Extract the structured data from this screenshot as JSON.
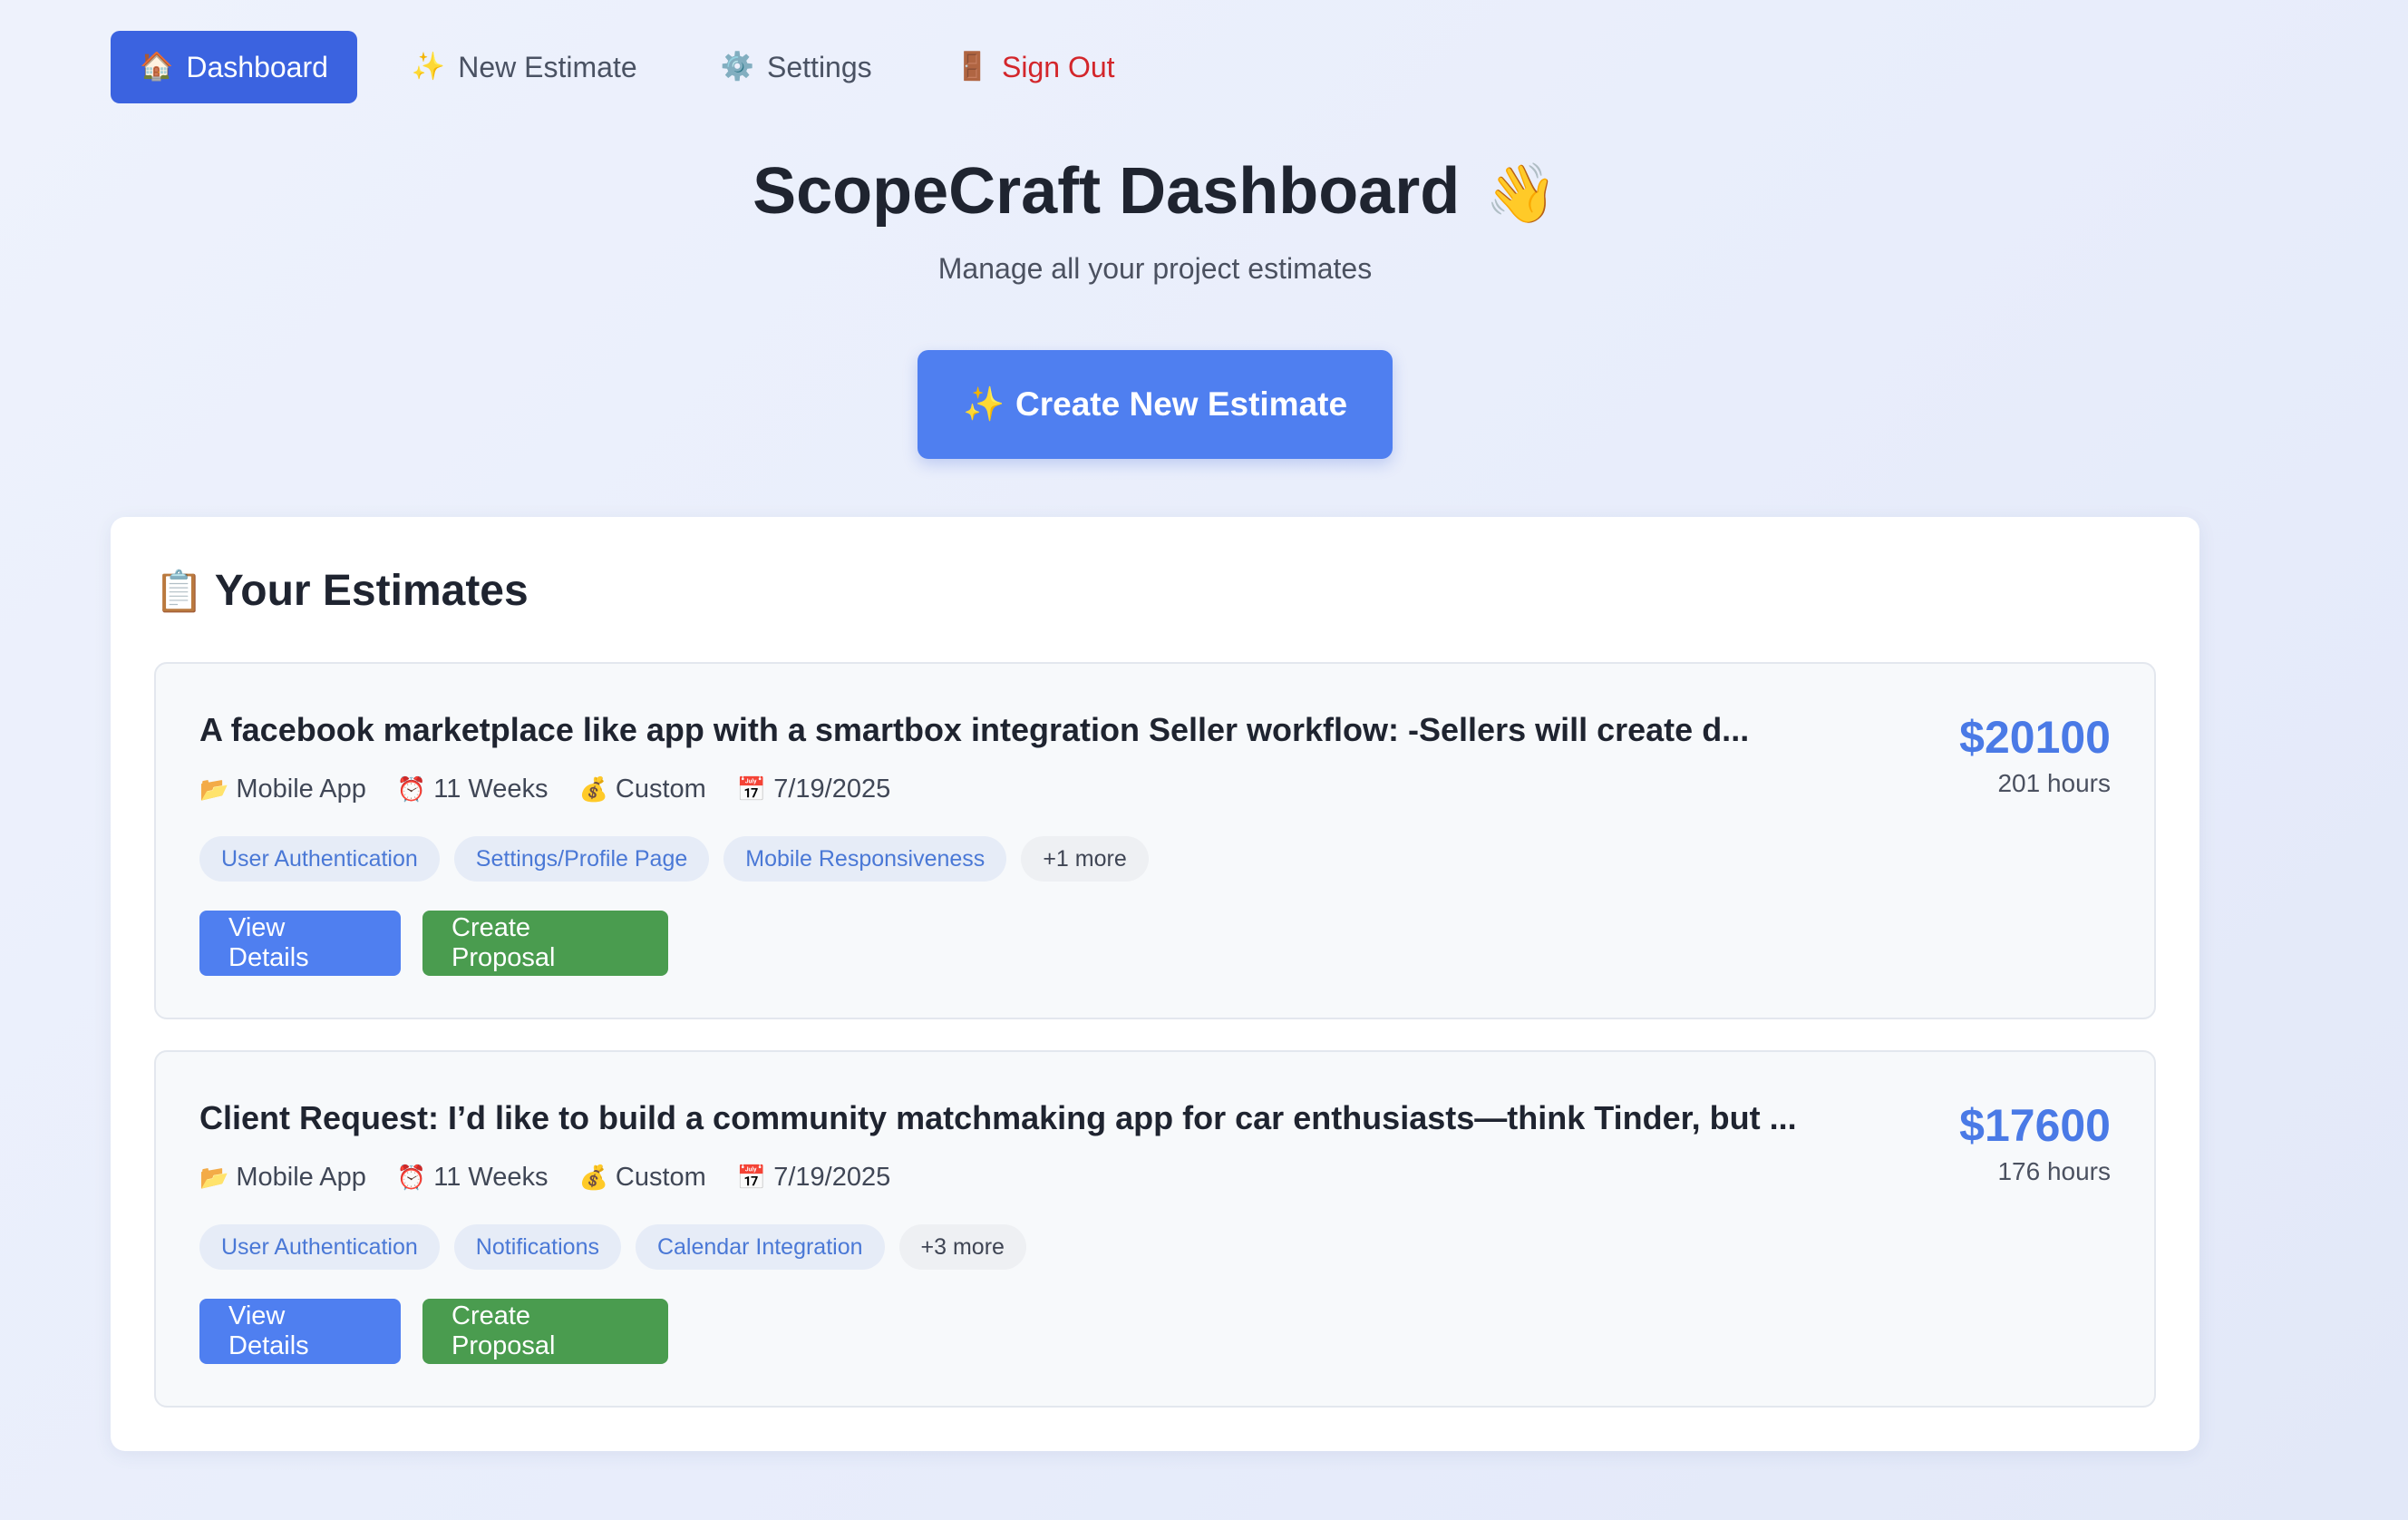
{
  "nav": {
    "items": [
      {
        "icon": "🏠",
        "icon_name": "house-icon",
        "label": "Dashboard"
      },
      {
        "icon": "✨",
        "icon_name": "sparkles-icon",
        "label": "New Estimate"
      },
      {
        "icon": "⚙️",
        "icon_name": "gear-icon",
        "label": "Settings"
      },
      {
        "icon": "🚪",
        "icon_name": "door-icon",
        "label": "Sign Out"
      }
    ]
  },
  "hero": {
    "title": "ScopeCraft Dashboard",
    "title_emoji": "👋",
    "subtitle": "Manage all your project estimates",
    "cta_icon": "✨",
    "cta_label": "Create New Estimate"
  },
  "estimates": {
    "icon": "📋",
    "title": "Your Estimates",
    "items": [
      {
        "title": "A facebook marketplace like app with a smartbox integration Seller workflow: -Sellers will create d...",
        "price": "$20100",
        "hours": "201 hours",
        "type_icon": "📂",
        "type": "Mobile App",
        "duration_icon": "⏰",
        "duration": "11 Weeks",
        "pricing_icon": "💰",
        "pricing": "Custom",
        "date_icon": "📅",
        "date": "7/19/2025",
        "tags": [
          "User Authentication",
          "Settings/Profile Page",
          "Mobile Responsiveness"
        ],
        "more": "+1 more",
        "view_label": "View Details",
        "proposal_label": "Create Proposal"
      },
      {
        "title": "Client Request: I’d like to build a community matchmaking app for car enthusiasts—think Tinder, but ...",
        "price": "$17600",
        "hours": "176 hours",
        "type_icon": "📂",
        "type": "Mobile App",
        "duration_icon": "⏰",
        "duration": "11 Weeks",
        "pricing_icon": "💰",
        "pricing": "Custom",
        "date_icon": "📅",
        "date": "7/19/2025",
        "tags": [
          "User Authentication",
          "Notifications",
          "Calendar Integration"
        ],
        "more": "+3 more",
        "view_label": "View Details",
        "proposal_label": "Create Proposal"
      }
    ]
  }
}
